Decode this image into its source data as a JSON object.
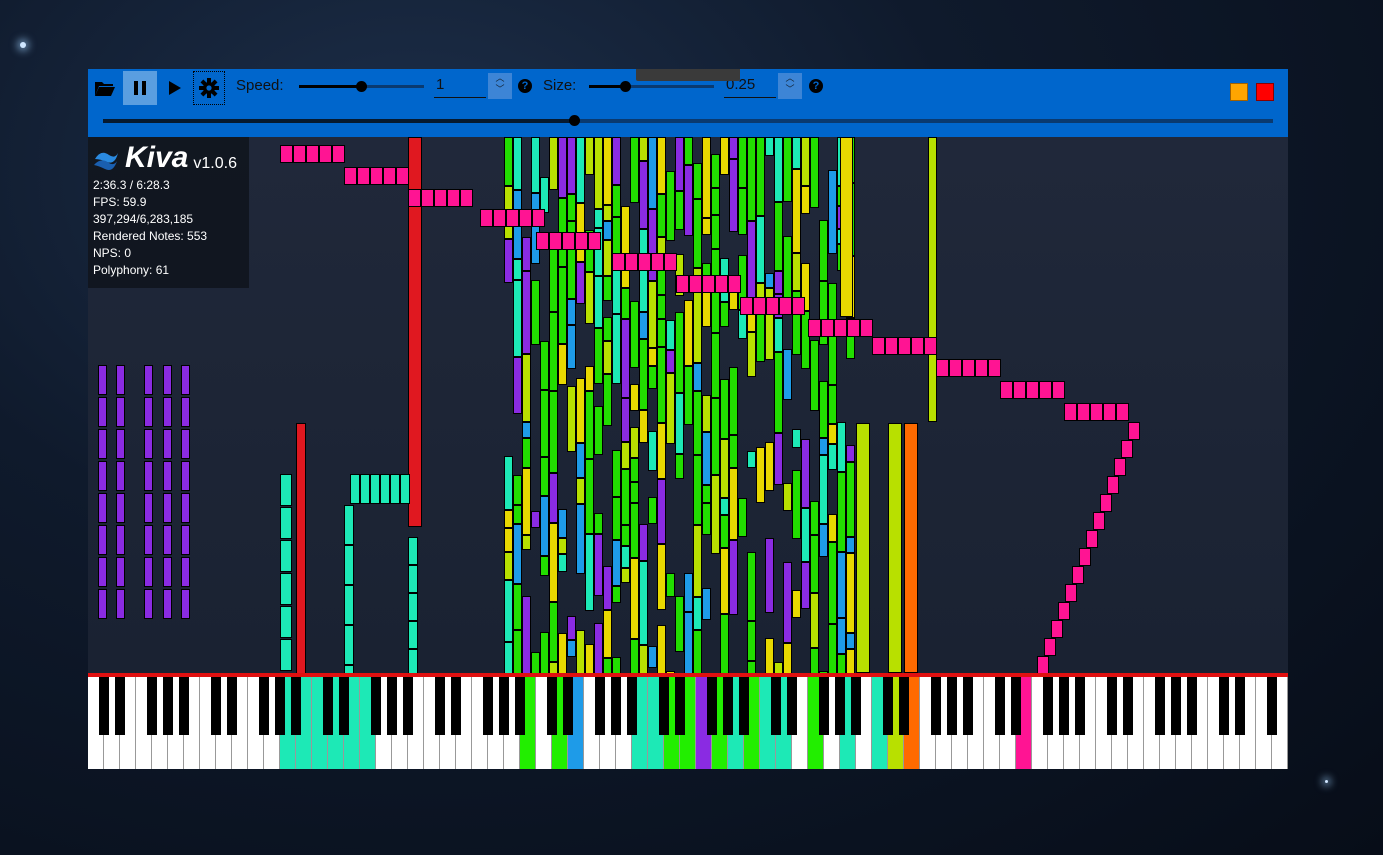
{
  "toolbar": {
    "open_icon": "folder-open-icon",
    "pause_icon": "pause-icon",
    "play_icon": "play-icon",
    "settings_icon": "gear-icon",
    "speed_label": "Speed:",
    "speed_value": "1",
    "speed_slider_fraction": 0.5,
    "size_label": "Size:",
    "size_value": "0.25",
    "size_slider_fraction": 0.28,
    "help": "?",
    "seek_fraction": 0.404,
    "minimize_color": "#ffa500",
    "close_color": "#ff0000",
    "accent": "#0066cc"
  },
  "info": {
    "app_name": "Kiva",
    "version": "v1.0.6",
    "time": "2:36.3 / 6:28.3",
    "fps": "FPS: 59.9",
    "notes": "397,294/6,283,185",
    "rendered": "Rendered Notes: 553",
    "nps": "NPS: 0",
    "polyphony": "Polyphony: 61"
  },
  "keyboard": {
    "pressed_colors": [
      "#1de9b6",
      "#22ee00",
      "#1e9be8",
      "#8a2be2",
      "#ff6a00",
      "#b8e000",
      "#ff1493"
    ]
  }
}
